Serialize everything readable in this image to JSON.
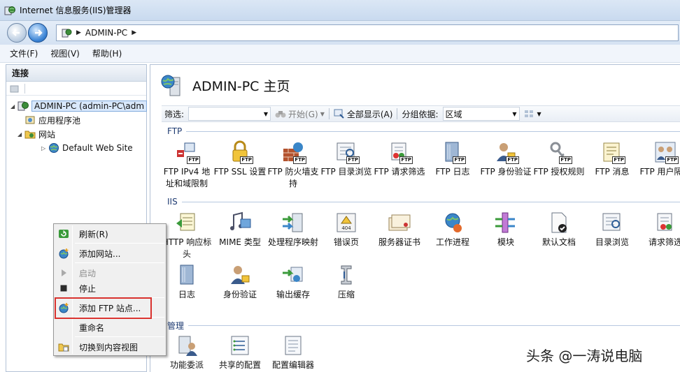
{
  "window": {
    "title": "Internet 信息服务(IIS)管理器"
  },
  "address": {
    "crumbs": [
      "ADMIN-PC"
    ]
  },
  "menu": {
    "file": "文件(F)",
    "view": "视图(V)",
    "help": "帮助(H)"
  },
  "connections": {
    "header": "连接",
    "tree": {
      "server": "ADMIN-PC (admin-PC\\adm",
      "app_pools": "应用程序池",
      "sites": "网站",
      "default_site": "Default Web Site"
    }
  },
  "main": {
    "title": "ADMIN-PC 主页",
    "filter": {
      "label": "筛选:",
      "start": "开始(G)",
      "show_all": "全部显示(A)",
      "group_by_label": "分组依据:",
      "group_by_value": "区域"
    },
    "sections": {
      "ftp": "FTP",
      "iis": "IIS",
      "manage": "管理"
    },
    "ftp_features": [
      "FTP IPv4 地址和域限制",
      "FTP SSL 设置",
      "FTP 防火墙支持",
      "FTP 目录浏览",
      "FTP 请求筛选",
      "FTP 日志",
      "FTP 身份验证",
      "FTP 授权规则",
      "FTP 消息",
      "FTP 用户隔离"
    ],
    "iis_features": [
      "HTTP 响应标头",
      "MIME 类型",
      "处理程序映射",
      "错误页",
      "服务器证书",
      "工作进程",
      "模块",
      "默认文档",
      "目录浏览",
      "请求筛选",
      "日志",
      "身份验证",
      "输出缓存",
      "压缩"
    ],
    "manage_features": [
      "功能委派",
      "共享的配置",
      "配置编辑器"
    ]
  },
  "context_menu": {
    "refresh": "刷新(R)",
    "add_site": "添加网站...",
    "start": "启动",
    "stop": "停止",
    "add_ftp": "添加 FTP 站点...",
    "rename": "重命名",
    "switch_view": "切换到内容视图"
  },
  "watermark": "头条 @一涛说电脑",
  "colors": {
    "highlight": "#d9322e",
    "section_text": "#1e3b72"
  }
}
